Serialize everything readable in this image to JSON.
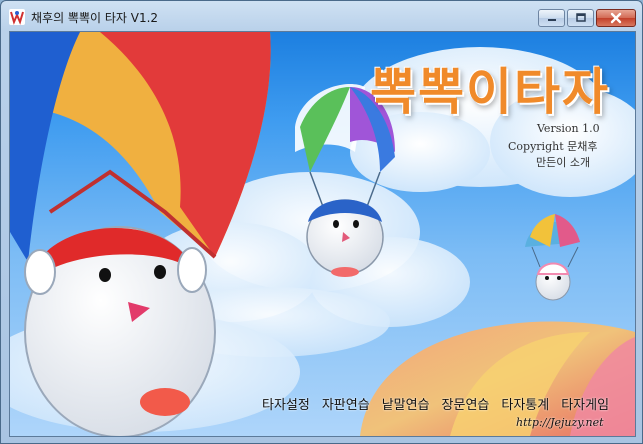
{
  "window": {
    "title": "채후의 뽁뽁이 타자 V1.2",
    "app_icon": "app-logo-icon",
    "controls": {
      "minimize": "minimize-icon",
      "maximize": "maximize-icon",
      "close": "close-icon"
    }
  },
  "splash": {
    "logo_text": "뽁뽁이타자",
    "version": "Version 1.0",
    "copyright": "Copyright 문채후",
    "maker": "만든이 소개"
  },
  "menu": {
    "items": [
      {
        "label": "타자설정"
      },
      {
        "label": "자판연습"
      },
      {
        "label": "낱말연습"
      },
      {
        "label": "장문연습"
      },
      {
        "label": "타자통계"
      },
      {
        "label": "타자게임"
      }
    ]
  },
  "footer": {
    "site": "http://Jejuzy.net"
  },
  "colors": {
    "sky_top": "#1c7fe0",
    "sky_bottom": "#aed5fa",
    "logo_orange": "#f08a2a",
    "close_red": "#c2402a"
  }
}
